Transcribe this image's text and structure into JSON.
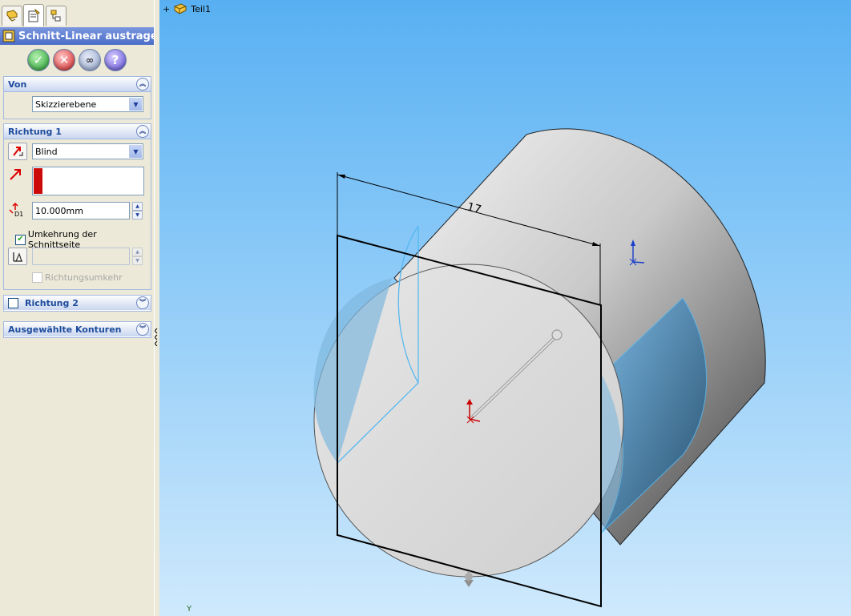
{
  "panel": {
    "tabs": [
      {
        "name": "feature-manager",
        "icon": "feature-tree-icon"
      },
      {
        "name": "property-manager",
        "icon": "property-manager-icon",
        "active": true
      },
      {
        "name": "configuration-manager",
        "icon": "configuration-icon"
      }
    ],
    "feature_title": "Schnitt-Linear austrage...",
    "actions": {
      "ok": "✓",
      "cancel": "✕",
      "preview": "∞",
      "help": "?"
    },
    "von": {
      "title": "Von",
      "collapse": "︽",
      "selected": "Skizzierebene"
    },
    "richtung1": {
      "title": "Richtung 1",
      "collapse": "︽",
      "end_condition": "Blind",
      "depth_value": "10.000mm",
      "reverse_side_label": "Umkehrung der Schnittseite",
      "reverse_side_checked": true,
      "reverse_direction_label": "Richtungsumkehr",
      "reverse_direction_checked": false
    },
    "richtung2": {
      "title": "Richtung 2",
      "collapse": "︾",
      "checked": false
    },
    "konturen": {
      "title": "Ausgewählte Konturen",
      "collapse": "︾"
    }
  },
  "viewport": {
    "tree_expand": "+",
    "tree_root": "Teil1",
    "dimension": "17",
    "axis_label": "Y"
  },
  "colors": {
    "title_bar": "#4c6ec9",
    "viewport_top": "#58b0f2",
    "viewport_bottom": "#cfe9fc",
    "edge_highlight": "#55b8f0",
    "selection_red": "#cc0000"
  }
}
